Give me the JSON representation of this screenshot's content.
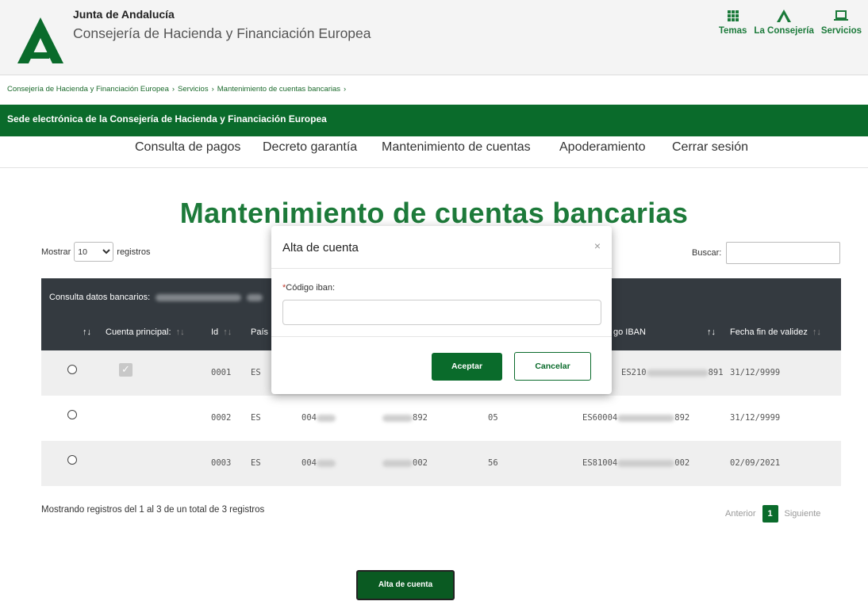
{
  "header": {
    "org_name": "Junta de Andalucía",
    "org_sub": "Consejería de Hacienda y Financiación Europea",
    "nav": [
      {
        "label": "Temas",
        "icon": "grid-icon"
      },
      {
        "label": "La Consejería",
        "icon": "andalucia-a-icon"
      },
      {
        "label": "Servicios",
        "icon": "laptop-icon"
      }
    ]
  },
  "breadcrumb": [
    "Consejería de Hacienda y Financiación Europea",
    "Servicios",
    "Mantenimiento de cuentas bancarias"
  ],
  "band_title": "Sede electrónica de la Consejería de Hacienda y Financiación Europea",
  "main_nav": [
    "Consulta de pagos",
    "Decreto garantía",
    "Mantenimiento de cuentas",
    "Apoderamiento",
    "Cerrar sesión"
  ],
  "page_title": "Mantenimiento de cuentas bancarias",
  "list_controls": {
    "show_label": "Mostrar",
    "show_value": "10",
    "show_suffix": "registros",
    "search_label": "Buscar:"
  },
  "table": {
    "caption": "Consulta datos bancarios:",
    "headers": [
      "Cuenta principal:",
      "Id",
      "País",
      "go IBAN",
      "Fecha fin de validez"
    ],
    "rows": [
      {
        "principal": true,
        "id": "0001",
        "pais": "ES",
        "iban_end": "891",
        "iban_start": "ES210",
        "fecha": "31/12/9999"
      },
      {
        "principal": false,
        "id": "0002",
        "pais": "ES",
        "banco": "004",
        "cuenta_end": "892",
        "dc": "05",
        "iban_start": "ES60004",
        "iban_end": "892",
        "fecha": "31/12/9999"
      },
      {
        "principal": false,
        "id": "0003",
        "pais": "ES",
        "banco": "004",
        "cuenta_end": "002",
        "dc": "56",
        "iban_start": "ES81004",
        "iban_end": "002",
        "fecha": "02/09/2021"
      }
    ]
  },
  "info": "Mostrando registros del 1 al 3 de un total de 3 registros",
  "pager": {
    "prev": "Anterior",
    "current": "1",
    "next": "Siguiente"
  },
  "add_button": "Alta de cuenta",
  "modal": {
    "title": "Alta de cuenta",
    "close": "×",
    "field_required_mark": "*",
    "field_label": "Código iban:",
    "field_value": "",
    "ok": "Aceptar",
    "cancel": "Cancelar"
  },
  "colors": {
    "brand_green": "#0a6b2b",
    "title_green": "#1d7a3a",
    "table_dark": "#343a40"
  }
}
